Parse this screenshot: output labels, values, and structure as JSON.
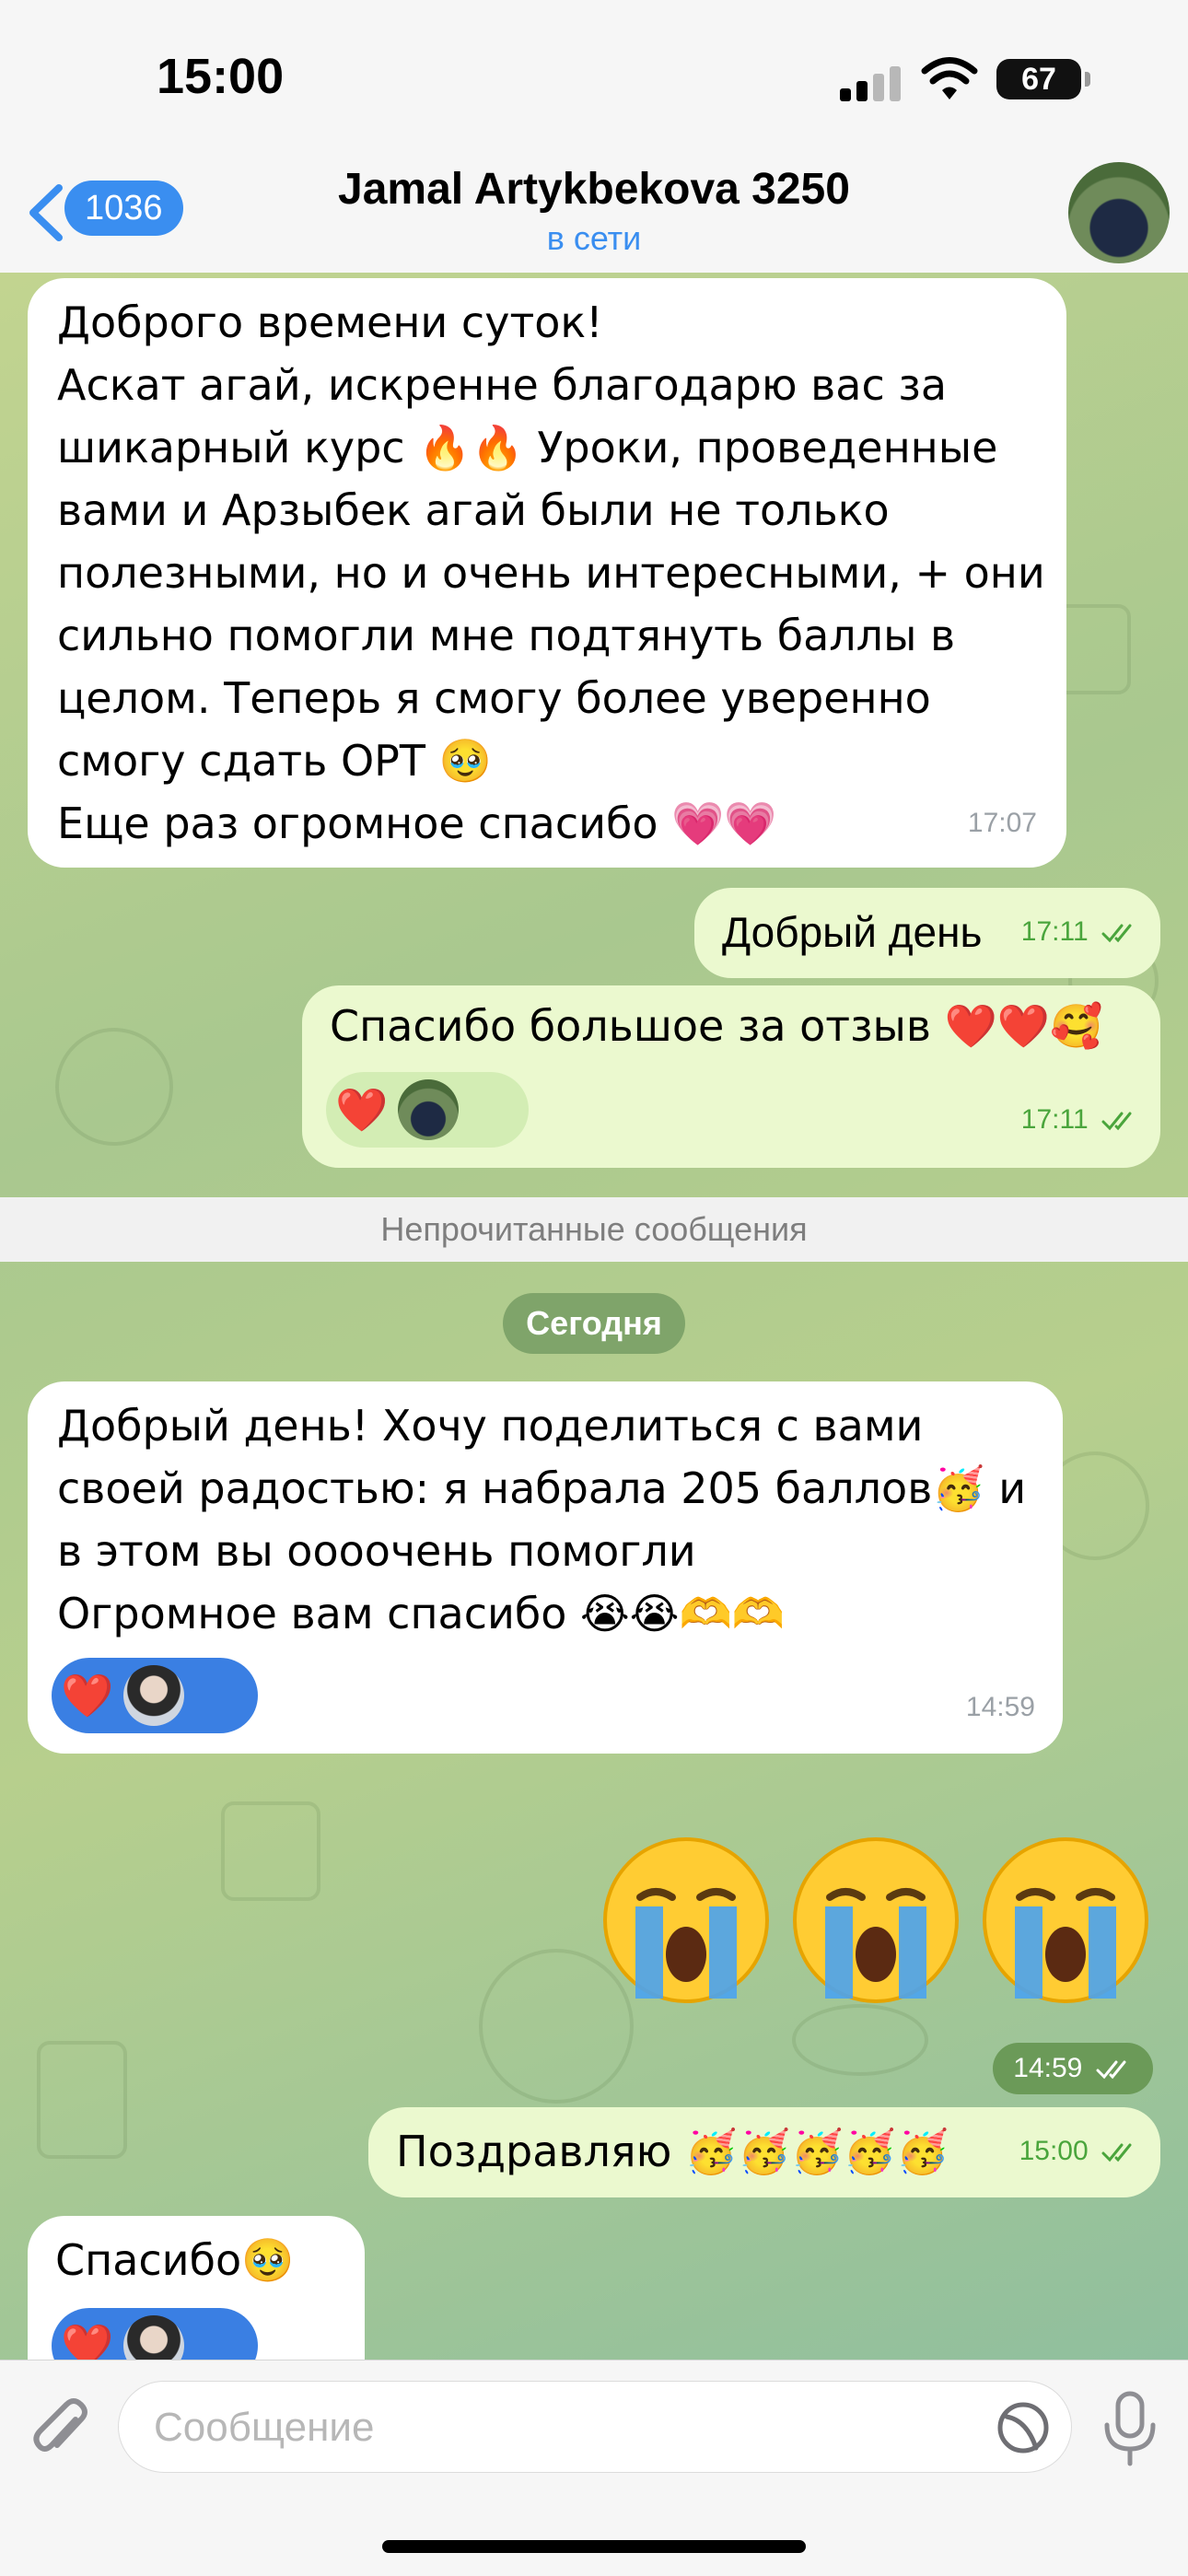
{
  "status_bar": {
    "time": "15:00",
    "battery": "67",
    "battery_level": 0.67
  },
  "header": {
    "back_icon": "chevron-left-icon",
    "unread_count": "1036",
    "title": "Jamal Artykbekova 3250",
    "subtitle": "в сети"
  },
  "messages": [
    {
      "text": "Доброго времени суток!\nАскат агай, искренне благодарю вас за\nшикарный курс 🔥🔥 Уроки, проведенные\nвами и Арзыбек агай были не только\nполезными, но и очень интересными, + они\nсильно помогли мне подтянуть баллы в\nцелом. Теперь я смогу более уверенно\nсмогу сдать ОРТ 🥹\nЕще раз огромное спасибо 💗💗",
      "time": "17:07"
    },
    {
      "text": "Добрый день",
      "time": "17:11"
    },
    {
      "text": "Спасибо большое за отзыв ❤️❤️🥰",
      "time": "17:11",
      "reaction": "❤️"
    },
    {
      "text": "Добрый день! Хочу поделиться с вами\nсвоей радостью: я набрала 205 баллов🥳 и\nв этом вы оооочень помогли\nОгромное вам спасибо 😭😭🫶🫶",
      "time": "14:59",
      "reaction": "❤️"
    },
    {
      "emoji": [
        "😭",
        "😭",
        "😭"
      ],
      "time": "14:59"
    },
    {
      "text": "Поздравляю 🥳🥳🥳🥳🥳",
      "time": "15:00"
    },
    {
      "text": "Спасибо🥹",
      "reaction": "❤️"
    }
  ],
  "separator": "Непрочитанные сообщения",
  "date_pill": "Сегодня",
  "input": {
    "placeholder": "Сообщение"
  },
  "colors": {
    "accent": "#3a8ef0",
    "incoming_bubble": "#ffffff",
    "outgoing_bubble": "#ebf9cf",
    "check_green": "#4aa53c",
    "chat_background": "#a9c48a"
  }
}
